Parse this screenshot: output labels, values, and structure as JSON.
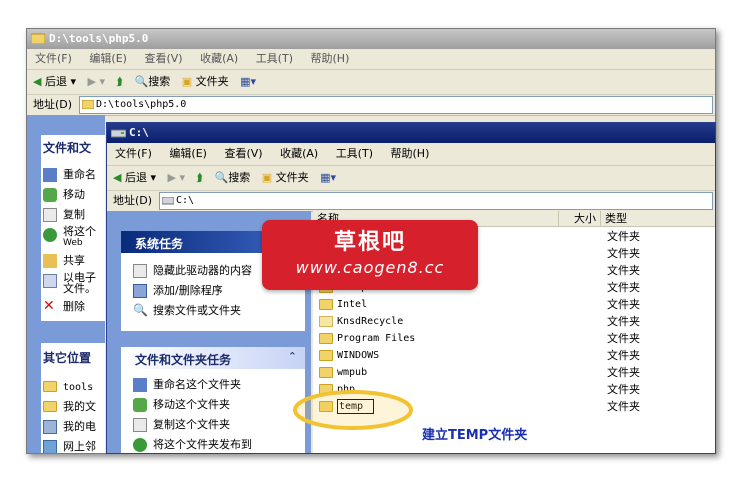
{
  "back_window": {
    "title": "D:\\tools\\php5.0",
    "menu": [
      "文件(F)",
      "编辑(E)",
      "查看(V)",
      "收藏(A)",
      "工具(T)",
      "帮助(H)"
    ],
    "toolbar": {
      "back": "后退",
      "search": "搜索",
      "folders": "文件夹"
    },
    "address_label": "地址(D)",
    "address_value": "D:\\tools\\php5.0",
    "file_tasks_header": "文件和文",
    "file_tasks": [
      "重命名",
      "移动",
      "复制",
      "将这个",
      "Web",
      "共享",
      "以电子",
      "文件。",
      "删除"
    ],
    "other_places_header": "其它位置",
    "other_places": [
      "tools",
      "我的文",
      "我的电",
      "网上邻"
    ]
  },
  "front_window": {
    "title": "C:\\",
    "menu": [
      "文件(F)",
      "编辑(E)",
      "查看(V)",
      "收藏(A)",
      "工具(T)",
      "帮助(H)"
    ],
    "toolbar": {
      "back": "后退",
      "search": "搜索",
      "folders": "文件夹"
    },
    "address_label": "地址(D)",
    "address_value": "C:\\",
    "system_tasks": {
      "header": "系统任务",
      "items": [
        "隐藏此驱动器的内容",
        "添加/删除程序",
        "搜索文件或文件夹"
      ]
    },
    "file_folder_tasks": {
      "header": "文件和文件夹任务",
      "items": [
        "重命名这个文件夹",
        "移动这个文件夹",
        "复制这个文件夹",
        "将这个文件夹发布到"
      ]
    },
    "columns": {
      "name": "名称",
      "size": "大小",
      "type": "类型"
    },
    "files": [
      {
        "name": "",
        "type": "文件夹"
      },
      {
        "name": "",
        "type": "文件夹"
      },
      {
        "name": "",
        "type": "文件夹"
      },
      {
        "name": "Inetpub",
        "type": "文件夹"
      },
      {
        "name": "Intel",
        "type": "文件夹"
      },
      {
        "name": "KnsdRecycle",
        "type": "文件夹"
      },
      {
        "name": "Program Files",
        "type": "文件夹"
      },
      {
        "name": "WINDOWS",
        "type": "文件夹"
      },
      {
        "name": "wmpub",
        "type": "文件夹"
      },
      {
        "name": "php",
        "type": "文件夹"
      },
      {
        "name": "temp",
        "type": "文件夹"
      }
    ],
    "rename_value": "temp"
  },
  "annotation": "建立TEMP文件夹",
  "watermark": {
    "title": "草根吧",
    "url": "www.caogen8.cc"
  },
  "colors": {
    "accent_blue": "#0a1f6e",
    "watermark_red": "#d6212c",
    "highlight_ring": "#f2c230"
  }
}
